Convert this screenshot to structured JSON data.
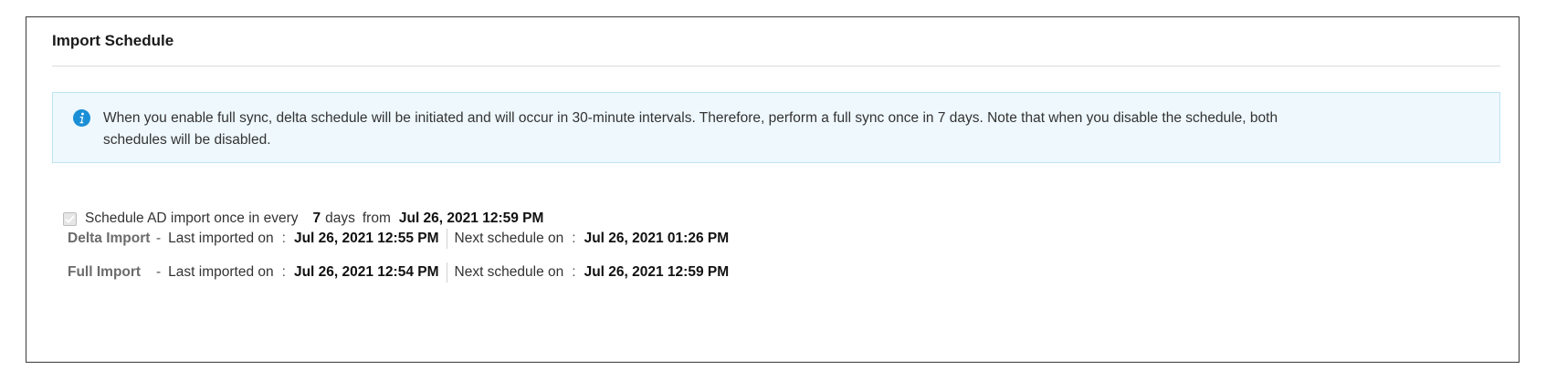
{
  "panel": {
    "title": "Import Schedule"
  },
  "info": {
    "icon": "info-icon",
    "color": "#1b8fd6",
    "text_line1": "When you enable full sync, delta schedule will be initiated and will occur in 30-minute intervals. Therefore, perform a full sync once in 7 days. Note that when you disable the schedule, both",
    "text_line2": "schedules will be disabled."
  },
  "schedule": {
    "checked": true,
    "label": "Schedule AD import once in every",
    "days_value": "7",
    "days_unit": "days",
    "from_label": "from",
    "from_datetime": "Jul 26, 2021 12:59 PM"
  },
  "imports": [
    {
      "name": "Delta Import",
      "dash": "-",
      "last_label": "Last imported on",
      "colon": ":",
      "last_value": "Jul 26, 2021 12:55 PM",
      "next_label": "Next schedule on",
      "next_value": "Jul 26, 2021 01:26 PM"
    },
    {
      "name": "Full Import",
      "dash": "-",
      "last_label": "Last imported on",
      "colon": ":",
      "last_value": "Jul 26, 2021 12:54 PM",
      "next_label": "Next schedule on",
      "next_value": "Jul 26, 2021 12:59 PM"
    }
  ]
}
